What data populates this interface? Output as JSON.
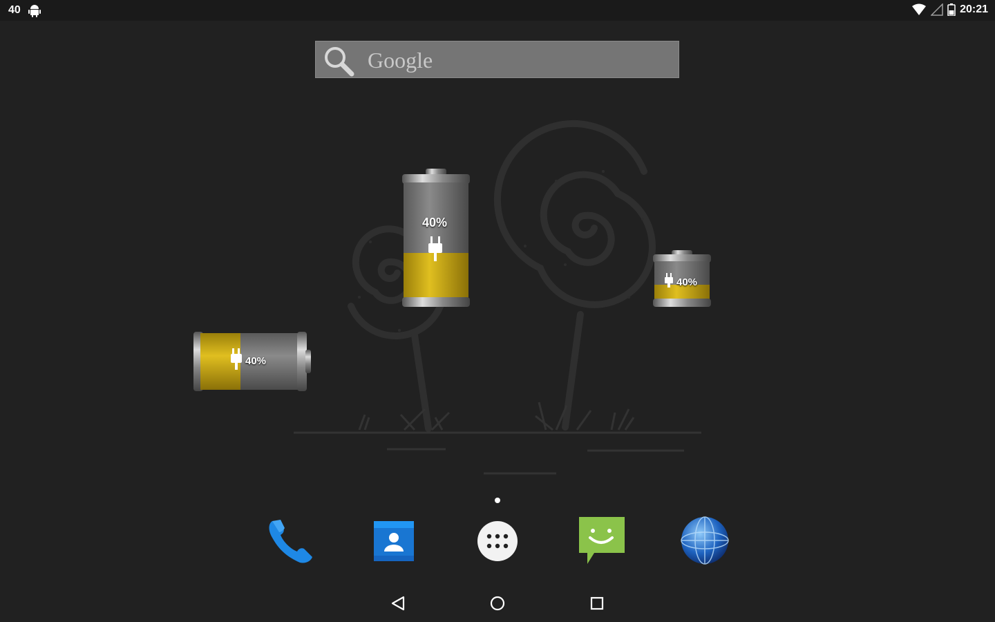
{
  "status_bar": {
    "notification_count": "40",
    "time": "20:21",
    "icons": [
      "android-icon",
      "wifi-icon",
      "signal-icon",
      "battery-icon"
    ]
  },
  "search": {
    "label": "Google",
    "icon": "search-icon"
  },
  "widgets": [
    {
      "label": "40%",
      "level": 0.4,
      "orientation": "vertical"
    },
    {
      "label": "40%",
      "level": 0.4,
      "orientation": "vertical-small"
    },
    {
      "label": "40%",
      "level": 0.4,
      "orientation": "horizontal"
    }
  ],
  "dock": [
    {
      "name": "phone",
      "icon": "phone-icon"
    },
    {
      "name": "contacts",
      "icon": "contacts-icon"
    },
    {
      "name": "app-drawer",
      "icon": "apps-grid-icon"
    },
    {
      "name": "messaging",
      "icon": "messaging-icon"
    },
    {
      "name": "browser",
      "icon": "globe-icon"
    }
  ],
  "navigation": [
    "back-icon",
    "home-icon",
    "recents-icon"
  ],
  "colors": {
    "accent_yellow": "#d4b012",
    "background": "#212121",
    "phone_blue": "#1e88e5",
    "message_green": "#8bc34a"
  }
}
